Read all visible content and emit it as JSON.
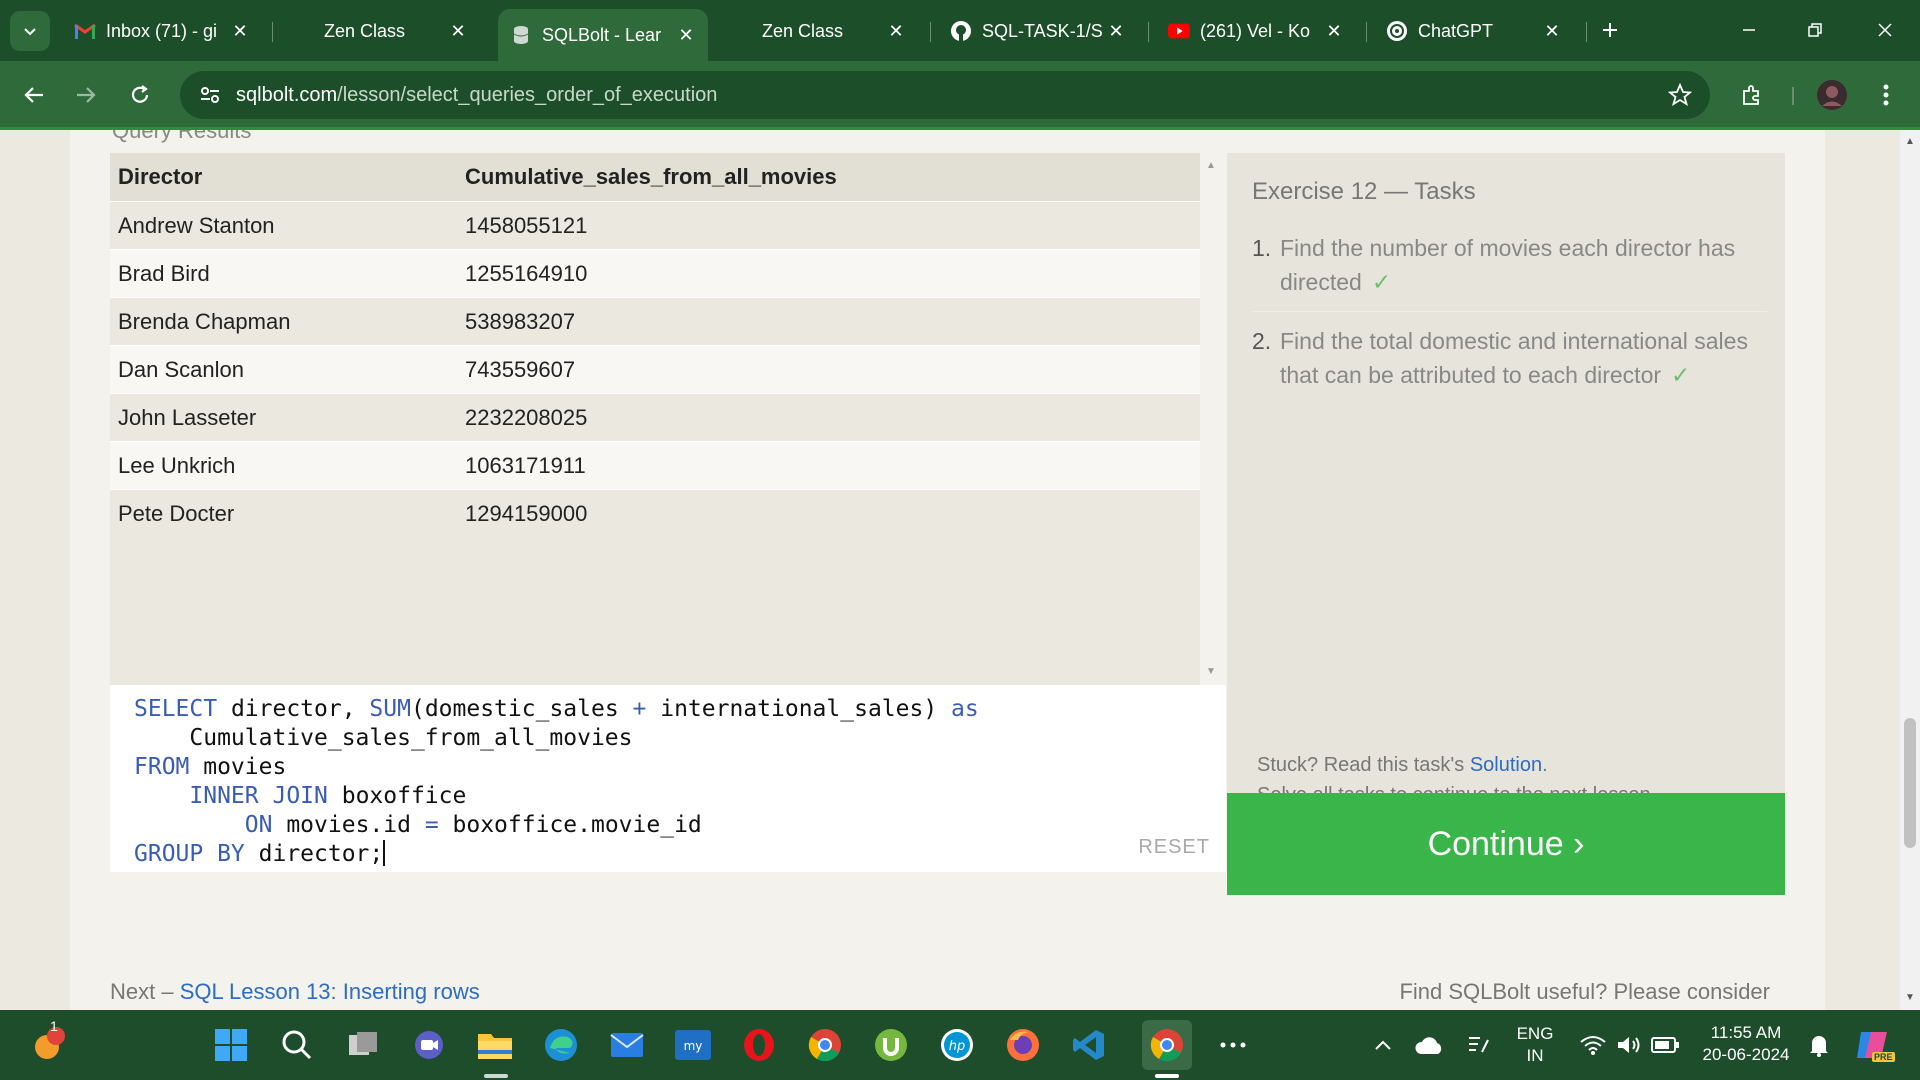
{
  "browser": {
    "tabs": [
      {
        "title": "Inbox (71) - gi",
        "icon": "gmail-icon",
        "active": false
      },
      {
        "title": "Zen Class",
        "icon": "blank-icon",
        "active": false
      },
      {
        "title": "SQLBolt - Lear",
        "icon": "sqlbolt-icon",
        "active": true
      },
      {
        "title": "Zen Class",
        "icon": "blank-icon",
        "active": false
      },
      {
        "title": "SQL-TASK-1/S",
        "icon": "github-icon",
        "active": false
      },
      {
        "title": "(261) Vel - Ko",
        "icon": "youtube-icon",
        "active": false
      },
      {
        "title": "ChatGPT",
        "icon": "chatgpt-icon",
        "active": false
      }
    ],
    "url_domain": "sqlbolt.com",
    "url_path": "/lesson/select_queries_order_of_execution"
  },
  "results": {
    "caption": "Query Results",
    "columns": [
      "Director",
      "Cumulative_sales_from_all_movies"
    ],
    "rows": [
      [
        "Andrew Stanton",
        "1458055121"
      ],
      [
        "Brad Bird",
        "1255164910"
      ],
      [
        "Brenda Chapman",
        "538983207"
      ],
      [
        "Dan Scanlon",
        "743559607"
      ],
      [
        "John Lasseter",
        "2232208025"
      ],
      [
        "Lee Unkrich",
        "1063171911"
      ],
      [
        "Pete Docter",
        "1294159000"
      ]
    ]
  },
  "editor": {
    "lines": [
      [
        {
          "t": "SELECT",
          "kw": true
        },
        {
          "t": " director, ",
          "kw": false
        },
        {
          "t": "SUM",
          "kw": true
        },
        {
          "t": "(domestic_sales ",
          "kw": false
        },
        {
          "t": "+",
          "kw": true
        },
        {
          "t": " international_sales) ",
          "kw": false
        },
        {
          "t": "as",
          "kw": true
        }
      ],
      [
        {
          "t": "    Cumulative_sales_from_all_movies",
          "kw": false
        }
      ],
      [
        {
          "t": "FROM",
          "kw": true
        },
        {
          "t": " movies",
          "kw": false
        }
      ],
      [
        {
          "t": "    ",
          "kw": false
        },
        {
          "t": "INNER JOIN",
          "kw": true
        },
        {
          "t": " boxoffice",
          "kw": false
        }
      ],
      [
        {
          "t": "        ",
          "kw": false
        },
        {
          "t": "ON",
          "kw": true
        },
        {
          "t": " movies.id ",
          "kw": false
        },
        {
          "t": "=",
          "kw": true
        },
        {
          "t": " boxoffice.movie_id",
          "kw": false
        }
      ],
      [
        {
          "t": "GROUP BY",
          "kw": true
        },
        {
          "t": " director;",
          "kw": false
        }
      ]
    ],
    "reset_label": "RESET"
  },
  "tasks": {
    "title": "Exercise 12 — Tasks",
    "items": [
      {
        "num": "1.",
        "text": "Find the number of movies each director has directed",
        "done_mark": "✓"
      },
      {
        "num": "2.",
        "text": "Find the total domestic and international sales that can be attributed to each director",
        "done_mark": "✓"
      }
    ],
    "stuck_prefix": "Stuck? Read this task's ",
    "solution_link": "Solution",
    "stuck_suffix": ".",
    "solve_all": "Solve all tasks to continue to the next lesson.",
    "continue_label": "Continue ›"
  },
  "footer": {
    "next_prefix": "Next – ",
    "next_link": "SQL Lesson 13: Inserting rows",
    "right_text": "Find SQLBolt useful? Please consider"
  },
  "taskbar": {
    "notification_badge": "1",
    "lang_line1": "ENG",
    "lang_line2": "IN",
    "time": "11:55 AM",
    "date": "20-06-2024",
    "copilot_badge": "PRE"
  },
  "colors": {
    "accent_green": "#3ab54a",
    "chrome_dark": "#1d4e2a",
    "chrome_toolbar": "#2f6a3b",
    "link_blue": "#2b6cc4",
    "keyword_blue": "#3a5db4",
    "check_green": "#6cc070"
  }
}
